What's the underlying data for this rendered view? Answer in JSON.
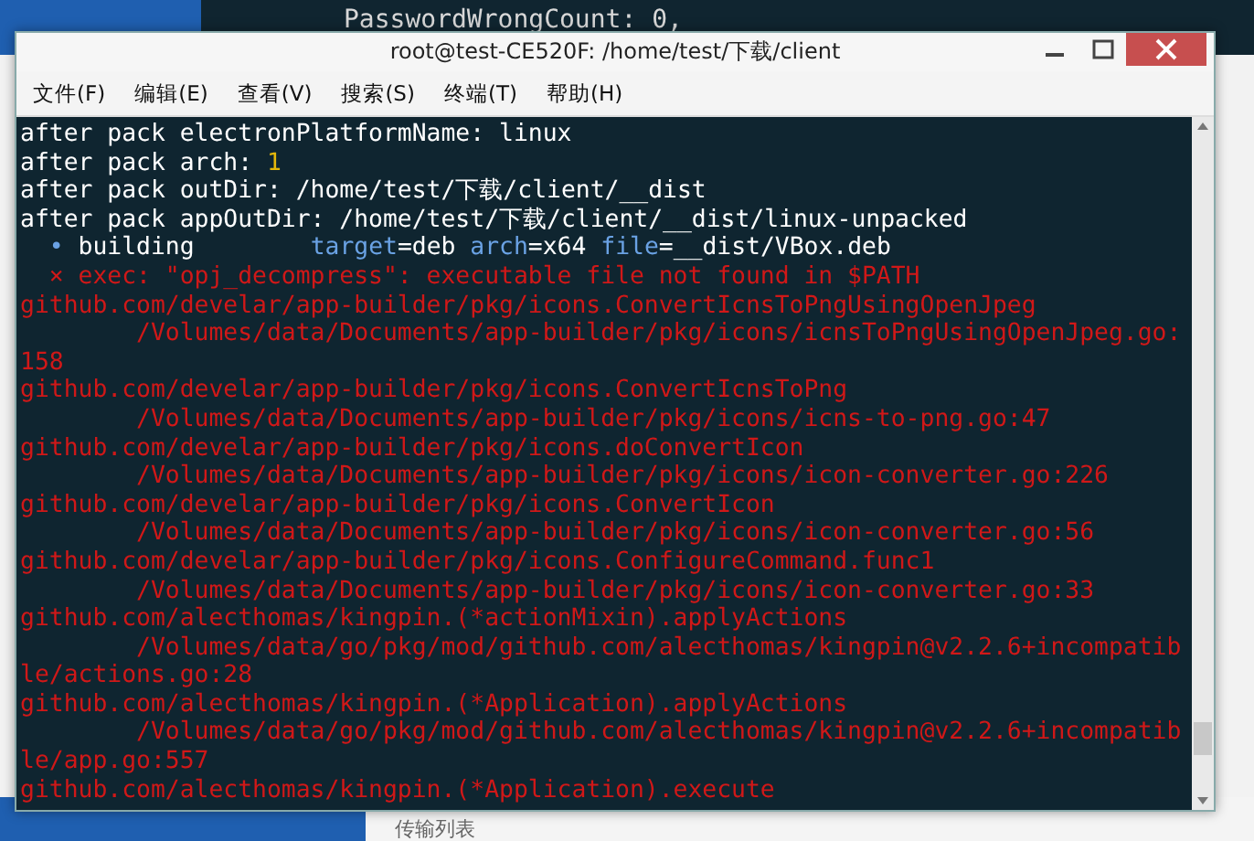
{
  "background": {
    "editor_line": "PasswordWrongCount: 0,",
    "tab_label": "传输列表"
  },
  "window": {
    "title": "root@test-CE520F: /home/test/下载/client"
  },
  "menu": [
    "文件(F)",
    "编辑(E)",
    "查看(V)",
    "搜索(S)",
    "终端(T)",
    "帮助(H)"
  ],
  "terminal_lines": [
    [
      {
        "text": "after pack electronPlatformName: linux",
        "kind": "plain"
      }
    ],
    [
      {
        "text": "after pack arch: ",
        "kind": "plain"
      },
      {
        "text": "1",
        "kind": "number"
      }
    ],
    [
      {
        "text": "after pack outDir: /home/test/下载/client/__dist",
        "kind": "plain"
      }
    ],
    [
      {
        "text": "after pack appOutDir: /home/test/下载/client/__dist/linux-unpacked",
        "kind": "plain"
      }
    ],
    [
      {
        "text": "  •",
        "kind": "key"
      },
      {
        "text": " building        ",
        "kind": "plain"
      },
      {
        "text": "target",
        "kind": "key"
      },
      {
        "text": "=deb ",
        "kind": "plain"
      },
      {
        "text": "arch",
        "kind": "key"
      },
      {
        "text": "=x64 ",
        "kind": "plain"
      },
      {
        "text": "file",
        "kind": "key"
      },
      {
        "text": "=__dist/VBox.deb",
        "kind": "plain"
      }
    ],
    [
      {
        "text": "  ⨯ exec: \"opj_decompress\": executable file not found in $PATH",
        "kind": "error"
      }
    ],
    [
      {
        "text": "github.com/develar/app-builder/pkg/icons.ConvertIcnsToPngUsingOpenJpeg",
        "kind": "error"
      }
    ],
    [
      {
        "text": "        /Volumes/data/Documents/app-builder/pkg/icons/icnsToPngUsingOpenJpeg.go:",
        "kind": "error"
      }
    ],
    [
      {
        "text": "158",
        "kind": "error"
      }
    ],
    [
      {
        "text": "github.com/develar/app-builder/pkg/icons.ConvertIcnsToPng",
        "kind": "error"
      }
    ],
    [
      {
        "text": "        /Volumes/data/Documents/app-builder/pkg/icons/icns-to-png.go:47",
        "kind": "error"
      }
    ],
    [
      {
        "text": "github.com/develar/app-builder/pkg/icons.doConvertIcon",
        "kind": "error"
      }
    ],
    [
      {
        "text": "        /Volumes/data/Documents/app-builder/pkg/icons/icon-converter.go:226",
        "kind": "error"
      }
    ],
    [
      {
        "text": "github.com/develar/app-builder/pkg/icons.ConvertIcon",
        "kind": "error"
      }
    ],
    [
      {
        "text": "        /Volumes/data/Documents/app-builder/pkg/icons/icon-converter.go:56",
        "kind": "error"
      }
    ],
    [
      {
        "text": "github.com/develar/app-builder/pkg/icons.ConfigureCommand.func1",
        "kind": "error"
      }
    ],
    [
      {
        "text": "        /Volumes/data/Documents/app-builder/pkg/icons/icon-converter.go:33",
        "kind": "error"
      }
    ],
    [
      {
        "text": "github.com/alecthomas/kingpin.(*actionMixin).applyActions",
        "kind": "error"
      }
    ],
    [
      {
        "text": "        /Volumes/data/go/pkg/mod/github.com/alecthomas/kingpin@v2.2.6+incompatib",
        "kind": "error"
      }
    ],
    [
      {
        "text": "le/actions.go:28",
        "kind": "error"
      }
    ],
    [
      {
        "text": "github.com/alecthomas/kingpin.(*Application).applyActions",
        "kind": "error"
      }
    ],
    [
      {
        "text": "        /Volumes/data/go/pkg/mod/github.com/alecthomas/kingpin@v2.2.6+incompatib",
        "kind": "error"
      }
    ],
    [
      {
        "text": "le/app.go:557",
        "kind": "error"
      }
    ],
    [
      {
        "text": "github.com/alecthomas/kingpin.(*Application).execute",
        "kind": "error"
      }
    ]
  ]
}
